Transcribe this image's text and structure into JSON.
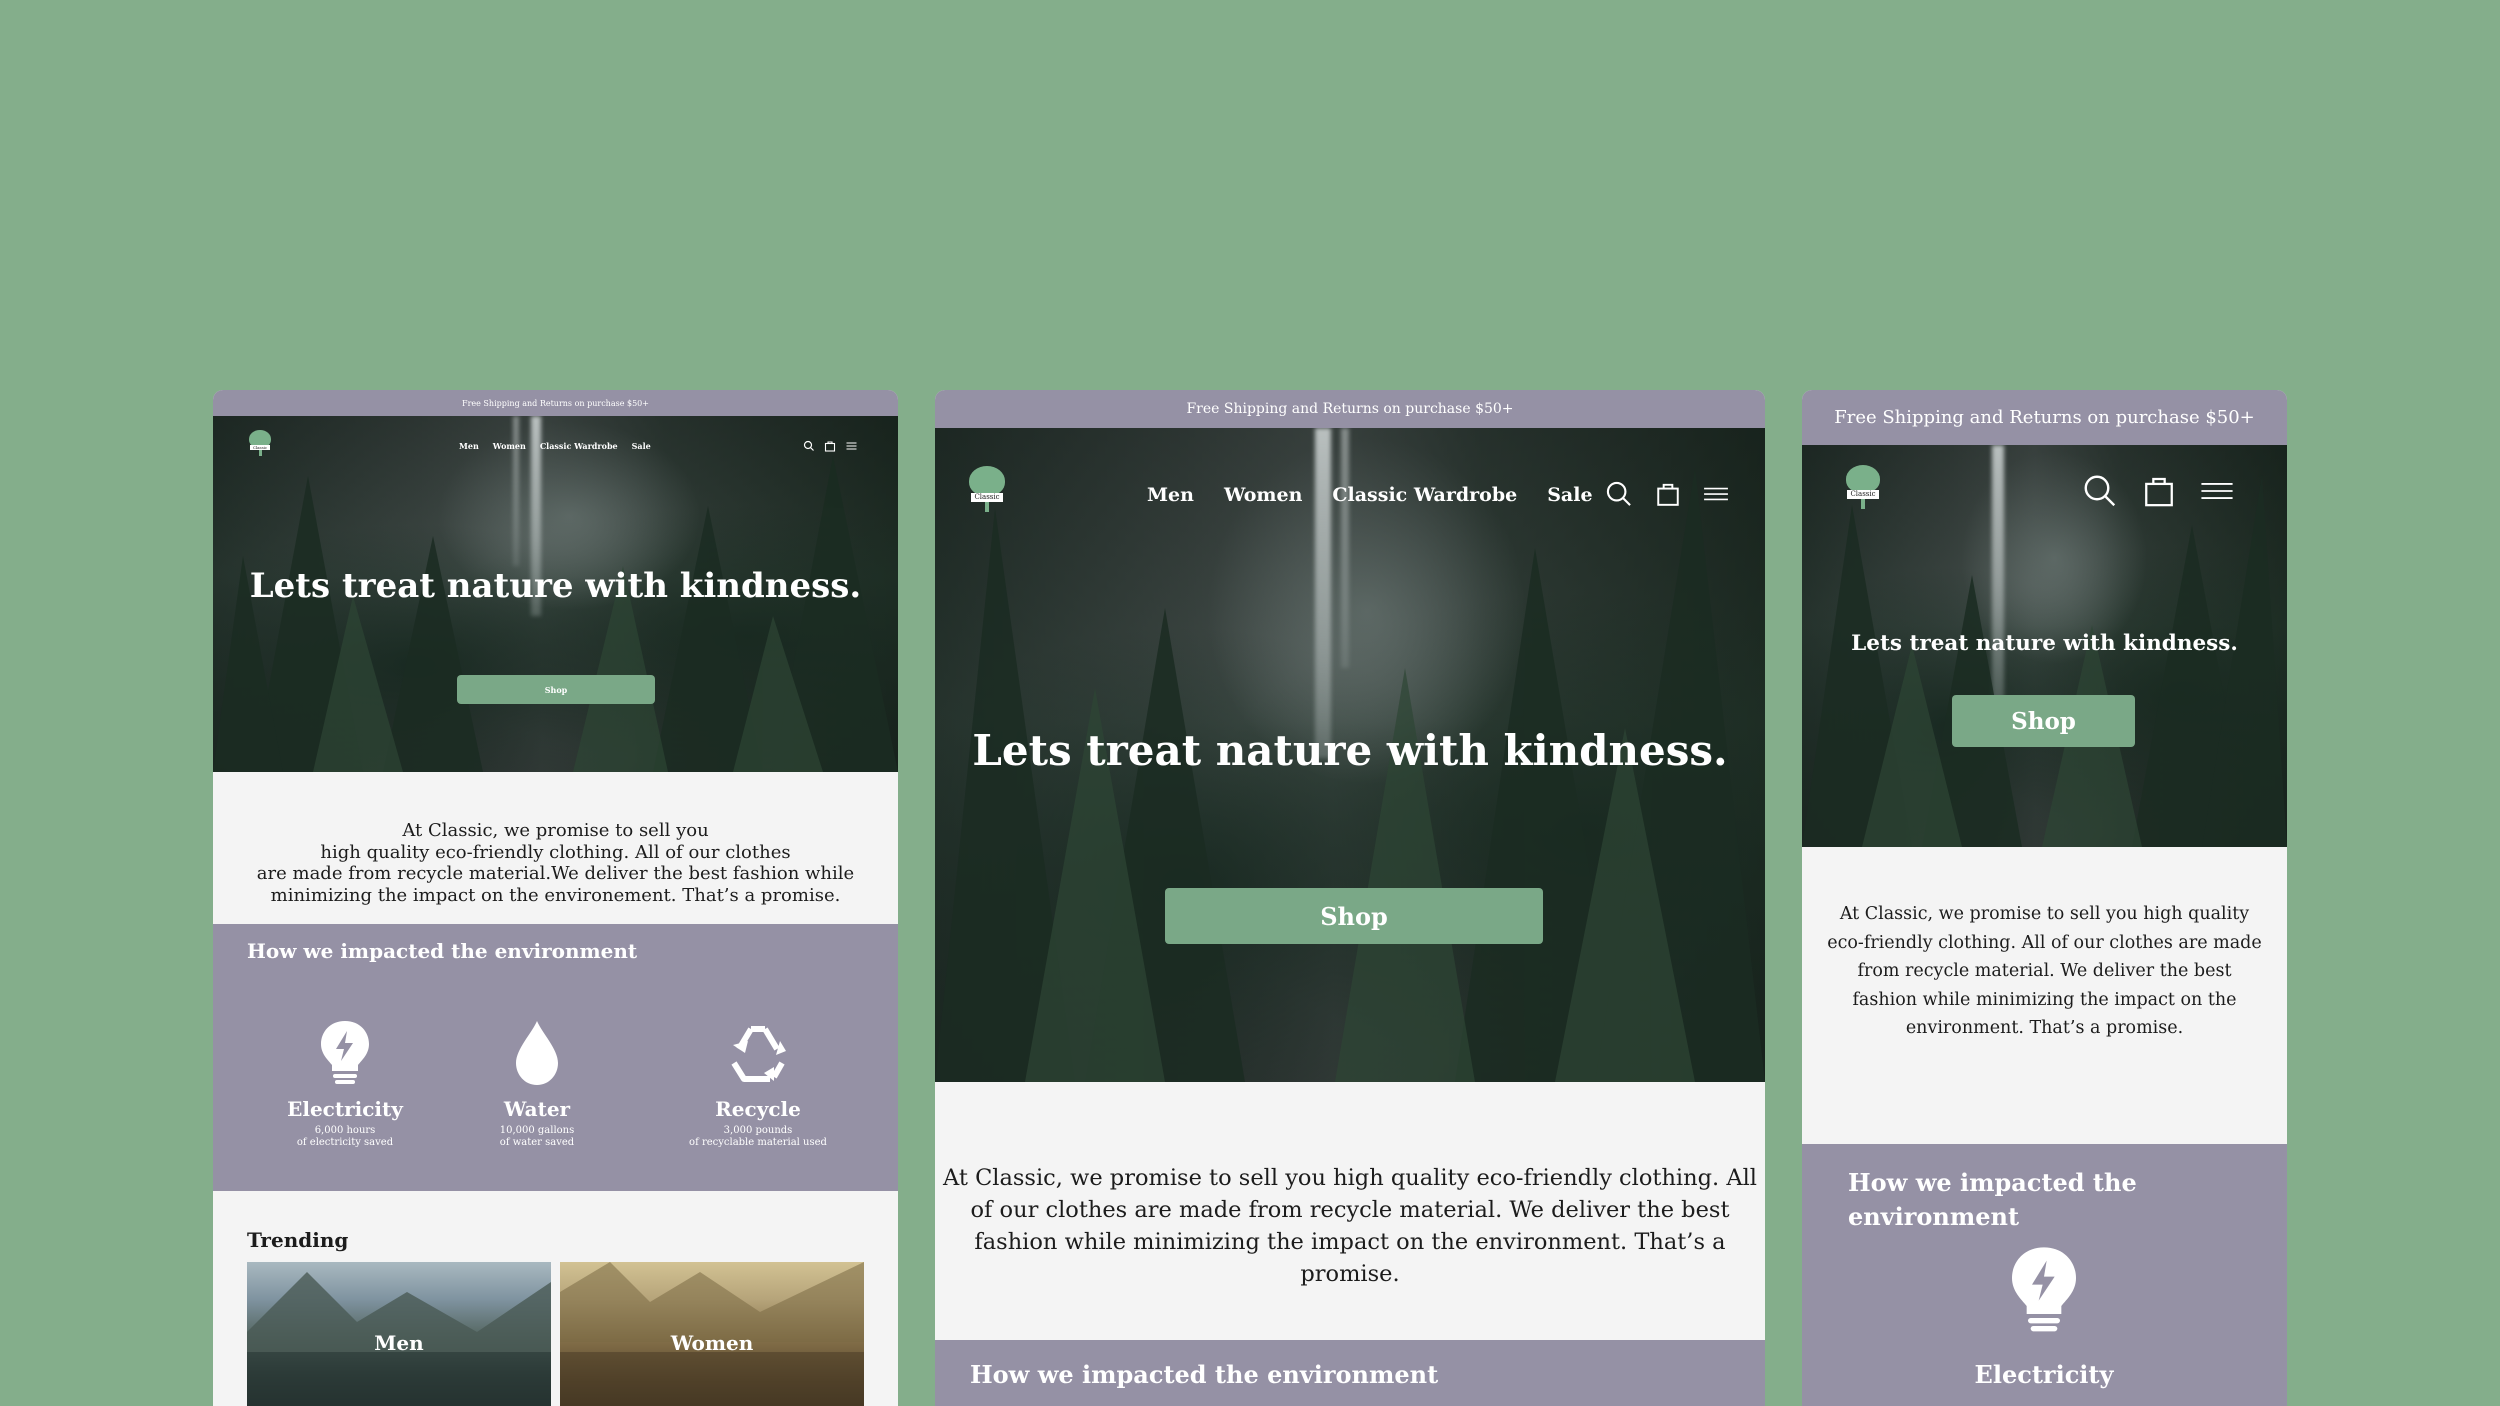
{
  "promo": "Free Shipping and Returns on purchase $50+",
  "logo_text": "Classic",
  "nav": [
    "Men",
    "Women",
    "Classic Wardrobe",
    "Sale"
  ],
  "hero_title": "Lets treat nature with kindness.",
  "shop_label": "Shop",
  "promise_desktop": [
    "At Classic, we promise to sell you",
    "high quality eco-friendly clothing. All of our clothes",
    "are made from recycle material.We deliver the best fashion while",
    "minimizing the impact on the environement. That’s a promise."
  ],
  "promise_tablet": [
    "At Classic, we promise to sell you high quality eco-friendly clothing. All",
    "of our clothes are made from recycle material. We deliver the best",
    "fashion while minimizing the impact on the environment. That’s a",
    "promise."
  ],
  "promise_mobile": [
    "At Classic, we promise to sell you high quality",
    "eco-friendly clothing. All of our clothes are made",
    "from recycle material. We deliver the best",
    "fashion while minimizing the impact on the",
    "environment. That’s a promise."
  ],
  "impact_title": "How we impacted the environment",
  "impact_title_mobile": [
    "How we impacted the",
    "environment"
  ],
  "stats": [
    {
      "icon": "lightbulb-icon",
      "label": "Electricity",
      "sub1": "6,000 hours",
      "sub2": "of electricity saved"
    },
    {
      "icon": "water-drop-icon",
      "label": "Water",
      "sub1": "10,000 gallons",
      "sub2": "of water saved"
    },
    {
      "icon": "recycle-icon",
      "label": "Recycle",
      "sub1": "3,000 pounds",
      "sub2": "of recyclable material used"
    }
  ],
  "trending_title": "Trending",
  "trending": [
    {
      "label": "Men"
    },
    {
      "label": "Women"
    }
  ],
  "colors": {
    "background": "#84ae8b",
    "promo_bar": "#9591a5",
    "button": "#7aa887",
    "content_bg": "#f4f4f4"
  }
}
